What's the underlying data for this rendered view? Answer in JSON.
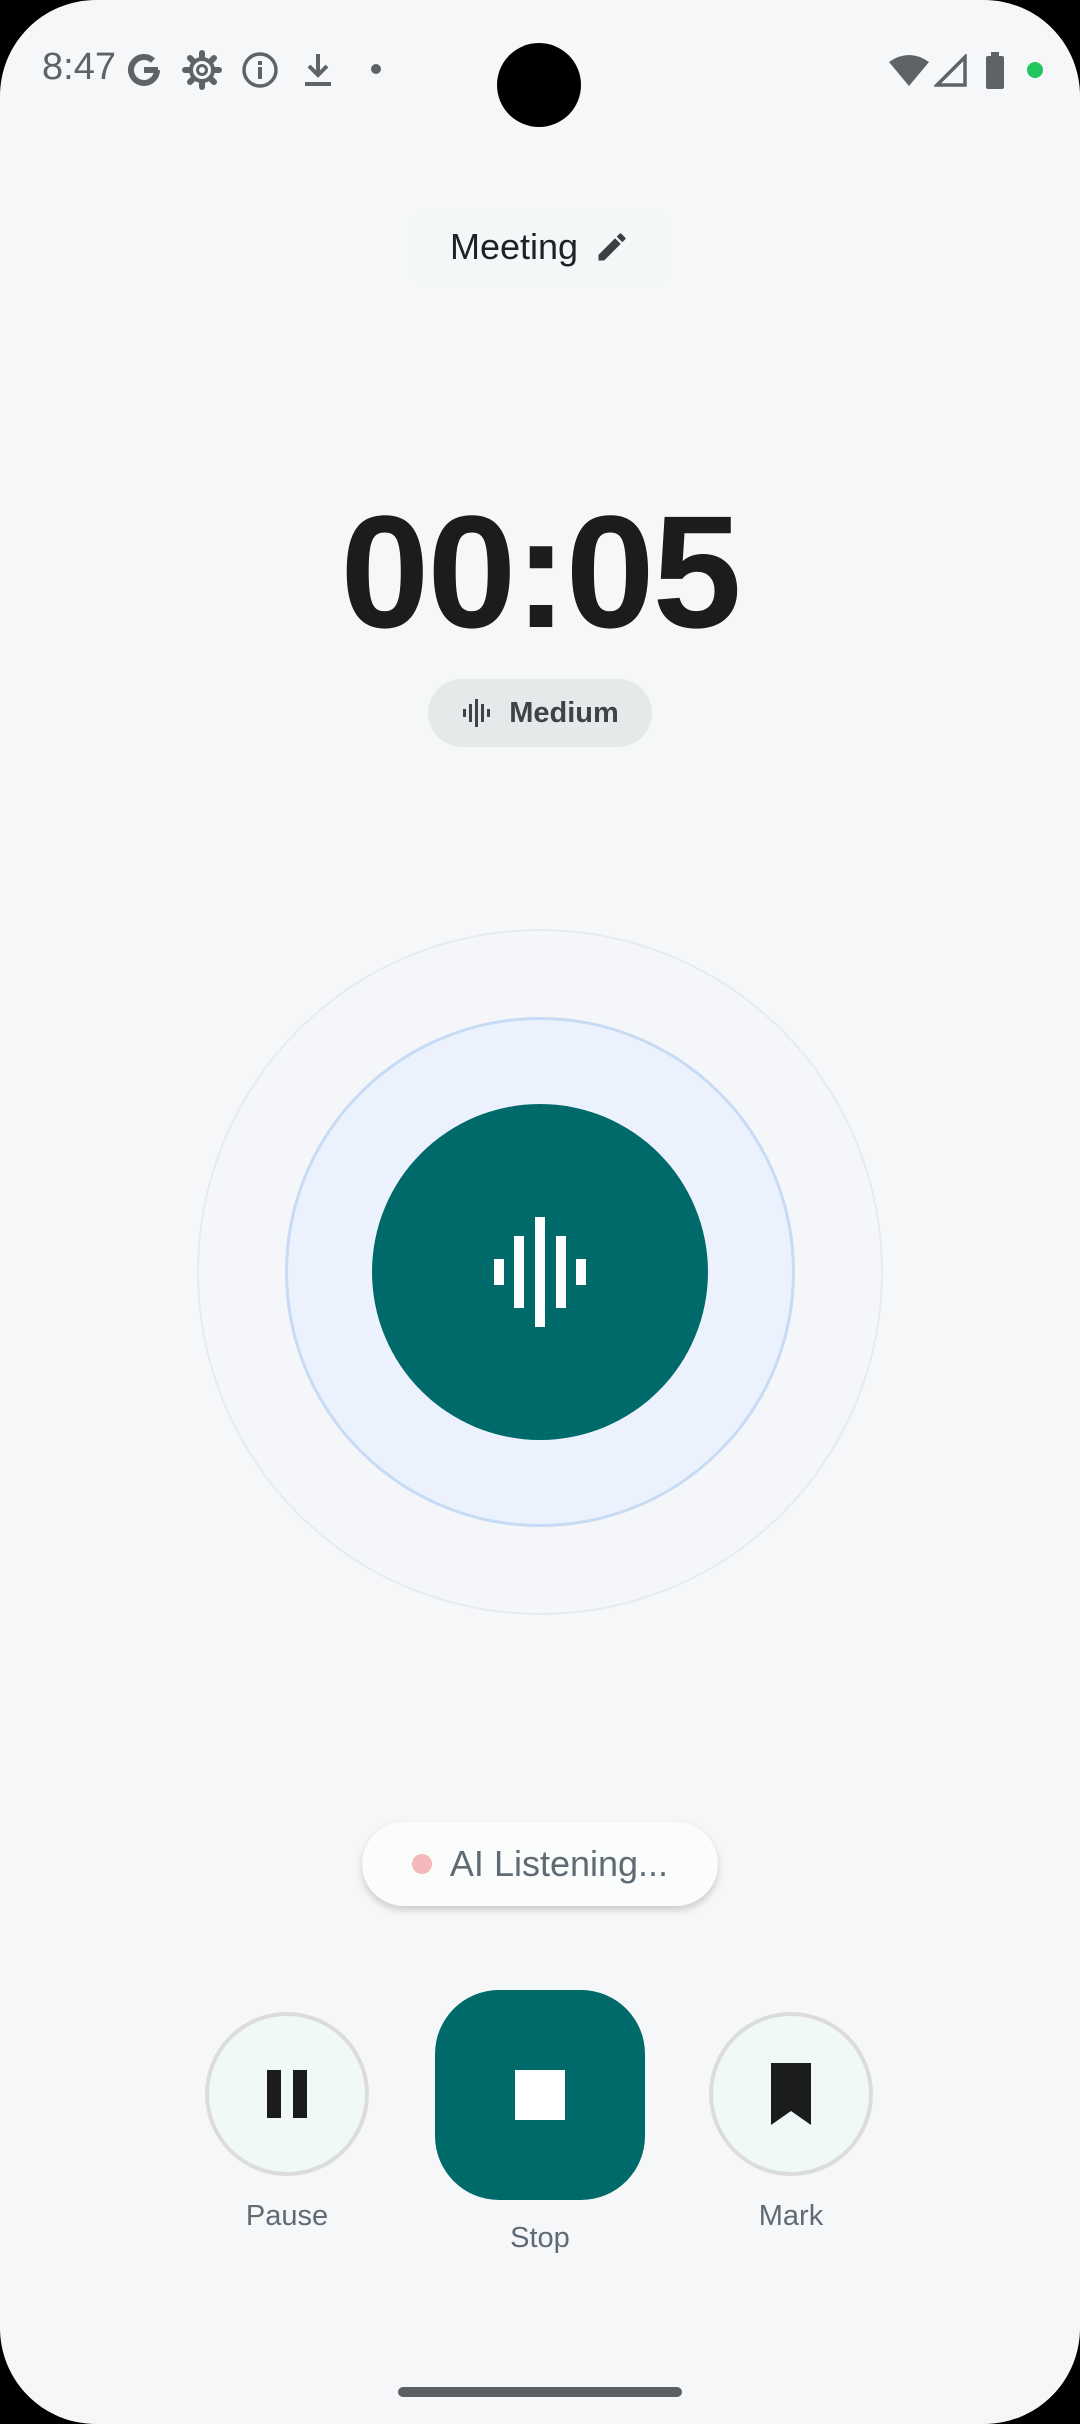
{
  "status_bar": {
    "time": "8:47",
    "icons": [
      "google-icon",
      "settings-icon",
      "info-icon",
      "download-icon",
      "dot-icon",
      "wifi-icon",
      "signal-icon",
      "battery-icon",
      "privacy-dot-icon"
    ]
  },
  "recording": {
    "title": "Meeting",
    "timer": "00:05",
    "quality": "Medium",
    "ai_status": "AI Listening..."
  },
  "controls": {
    "pause_label": "Pause",
    "stop_label": "Stop",
    "mark_label": "Mark"
  },
  "colors": {
    "accent": "#006a6a",
    "background": "#f6f7f9",
    "ai_dot": "#f4b7ba"
  }
}
